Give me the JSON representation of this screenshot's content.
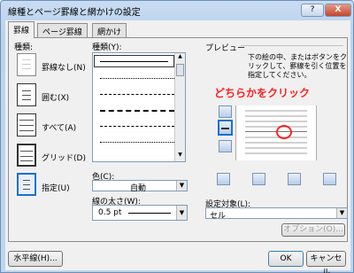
{
  "dialog": {
    "title": "線種とページ罫線と網かけの設定",
    "help": "?",
    "close": "X"
  },
  "tabs": [
    "罫線",
    "ページ罫線",
    "網かけ"
  ],
  "settings": {
    "label": "種類:",
    "items": [
      "罫線なし(N)",
      "囲む(X)",
      "すべて(A)",
      "グリッド(D)",
      "指定(U)"
    ]
  },
  "styles": {
    "label": "種類(Y):"
  },
  "color": {
    "label": "色(C):",
    "value": "自動"
  },
  "width": {
    "label": "線の太さ(W):",
    "value": "0.5 pt"
  },
  "preview": {
    "label": "プレビュー",
    "instruction": "下の絵の中、またはボタンをクリックして、罫線を引く位置を指定してください。",
    "annotation": "どちらかをクリック",
    "annotation_color": "#ff2020"
  },
  "applyto": {
    "label": "設定対象(L):",
    "value": "セル"
  },
  "buttons": {
    "options": "オプション(O)...",
    "horizontal": "水平線(H)...",
    "ok": "OK",
    "cancel": "キャンセル"
  }
}
